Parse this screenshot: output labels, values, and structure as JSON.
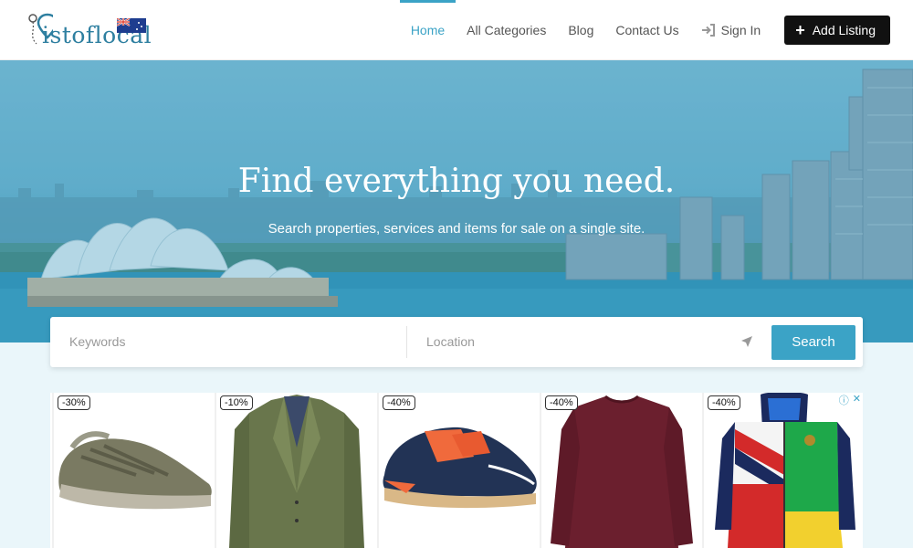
{
  "header": {
    "logo_text": "istoflocal",
    "nav": {
      "home": "Home",
      "categories": "All Categories",
      "blog": "Blog",
      "contact": "Contact Us",
      "signin": "Sign In",
      "add_listing": "Add Listing"
    }
  },
  "hero": {
    "title": "Find everything you need.",
    "subtitle": "Search properties, services and items for sale on a single site."
  },
  "search": {
    "keywords_placeholder": "Keywords",
    "location_placeholder": "Location",
    "button": "Search"
  },
  "ads": {
    "items": [
      {
        "discount": "-30%",
        "icon": "sneaker-grey"
      },
      {
        "discount": "-10%",
        "icon": "blazer-green"
      },
      {
        "discount": "-40%",
        "icon": "sneaker-navy-orange"
      },
      {
        "discount": "-40%",
        "icon": "sweater-burgundy"
      },
      {
        "discount": "-40%",
        "icon": "puffer-jacket-multicolor"
      }
    ]
  },
  "colors": {
    "accent": "#3ba3c6",
    "dark_button": "#111111",
    "lower_bg": "#eaf6fa"
  }
}
